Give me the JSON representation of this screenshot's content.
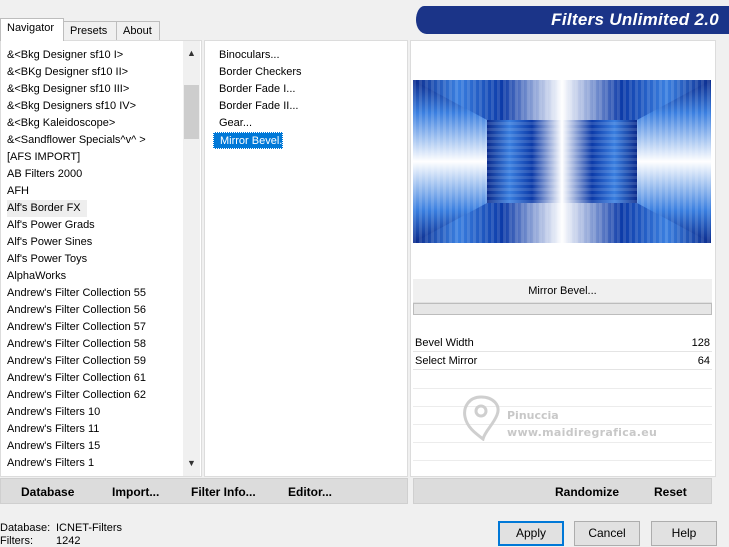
{
  "tabs": [
    {
      "label": "Navigator"
    },
    {
      "label": "Presets"
    },
    {
      "label": "About"
    }
  ],
  "title": "Filters Unlimited 2.0",
  "categories": [
    "&<Bkg Designer sf10 I>",
    "&<BKg Designer sf10 II>",
    "&<Bkg Designer sf10 III>",
    "&<Bkg Designers sf10 IV>",
    "&<Bkg Kaleidoscope>",
    "&<Sandflower Specials^v^ >",
    "[AFS IMPORT]",
    "AB Filters 2000",
    "AFH",
    "Alf's Border FX",
    "Alf's Power Grads",
    "Alf's Power Sines",
    "Alf's Power Toys",
    "AlphaWorks",
    "Andrew's Filter Collection 55",
    "Andrew's Filter Collection 56",
    "Andrew's Filter Collection 57",
    "Andrew's Filter Collection 58",
    "Andrew's Filter Collection 59",
    "Andrew's Filter Collection 61",
    "Andrew's Filter Collection 62",
    "Andrew's Filters 10",
    "Andrew's Filters 11",
    "Andrew's Filters 15",
    "Andrew's Filters 1"
  ],
  "filters": [
    "Binoculars...",
    "Border Checkers",
    "Border Fade I...",
    "Border Fade II...",
    "Gear...",
    "Mirror Bevel..."
  ],
  "left_buttons": {
    "database": "Database",
    "import": "Import...",
    "filter_info": "Filter Info...",
    "editor": "Editor..."
  },
  "right_buttons": {
    "randomize": "Randomize",
    "reset": "Reset"
  },
  "selected_filter_name": "Mirror Bevel...",
  "params": [
    {
      "label": "Bevel Width",
      "value": "128"
    },
    {
      "label": "Select Mirror",
      "value": "64"
    }
  ],
  "watermark": {
    "name": "Pinuccia",
    "url": "www.maidiregrafica.eu"
  },
  "status": {
    "database_label": "Database:",
    "database_value": "ICNET-Filters",
    "filters_label": "Filters:",
    "filters_value": "1242"
  },
  "dialog_buttons": {
    "apply": "Apply",
    "cancel": "Cancel",
    "help": "Help"
  },
  "colors": {
    "banner": "#1b3488",
    "selection": "#0078d7",
    "preview_dark": "#0a2a8c",
    "preview_light": "#ffffff"
  },
  "icons": {
    "scroll_up": "▲",
    "scroll_down": "▼"
  }
}
